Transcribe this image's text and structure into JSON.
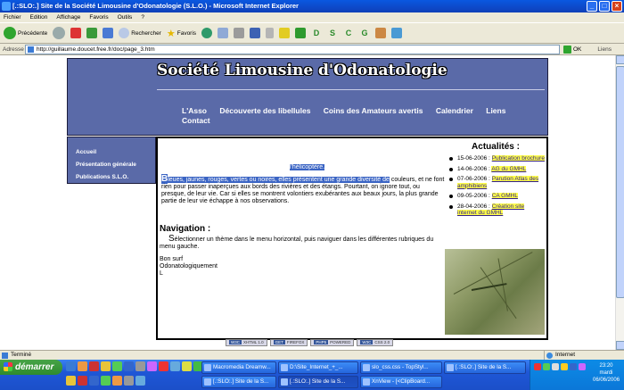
{
  "window": {
    "title": "[.:SLO:.] Site de la Société Limousine d'Odonatologie (S.L.O.) - Microsoft Internet Explorer"
  },
  "menu": [
    "Fichier",
    "Edition",
    "Affichage",
    "Favoris",
    "Outils",
    "?"
  ],
  "toolbar": {
    "back_label": "Précédente",
    "search_label": "Rechercher",
    "favorites_label": "Favoris",
    "letters": [
      "D",
      "S",
      "C",
      "G"
    ]
  },
  "address": {
    "label": "Adresse",
    "url": "http://guillaume.doucet.free.fr/doc/page_3.htm",
    "go_label": "OK",
    "links_label": "Liens"
  },
  "page": {
    "site_title": "Société Limousine d'Odonatologie",
    "nav": [
      "L'Asso",
      "Découverte des libellules",
      "Coins des Amateurs avertis",
      "Calendrier",
      "Liens",
      "Contact"
    ],
    "sidebar": [
      "Accueil",
      "Présentation générale",
      "Publications S.L.O."
    ],
    "caption": "l'hélicoptère.",
    "intro_initial": "B",
    "intro_highlight": "leues, jaunes, rouges, vertes ou noires, elles présentent une grande diversité de",
    "intro_rest": " couleurs, et ne font rien pour passer inaperçues aux bords des rivières et des étangs. Pourtant, on ignore tout, ou presque, de leur vie. Car si elles se montrent volontiers exubérantes aux beaux jours, la plus grande partie de leur vie échappe à nos observations.",
    "nav_title": "Navigation :",
    "nav_initial": "S",
    "nav_text": "électionner un thème dans le menu horizontal, puis naviguer dans les différentes rubriques du menu gauche.",
    "sign_lines": [
      "Bon surf",
      "Odonatologiquement",
      "L"
    ],
    "news_title": "Actualités :",
    "news": [
      {
        "date": "15-06-2006 :",
        "link": "Publication brochure"
      },
      {
        "date": "14-06-2006 :",
        "link": "AG du GMHL"
      },
      {
        "date": "07-06-2006 :",
        "link": "Parution Atlas des amphibiens"
      },
      {
        "date": "09-05-2006 :",
        "link": "CA GMHL"
      },
      {
        "date": "28-04-2006 :",
        "link": "Création site internet du GMHL"
      }
    ],
    "badges": [
      {
        "a": "W3C",
        "b": "XHTML 1.0"
      },
      {
        "a": "GET",
        "b": "FIREFOX"
      },
      {
        "a": "PHP5",
        "b": "POWERED"
      },
      {
        "a": "W3C",
        "b": "CSS 2.0"
      }
    ]
  },
  "status": {
    "text": "Terminé",
    "zone": "Internet"
  },
  "taskbar": {
    "start_label": "démarrer",
    "tasks_row1": [
      "Macromedia Dreamw...",
      "D:\\Site_Internet_+_...",
      "slo_css.css - TopStyl...",
      "[.:SLO:.] Site de la S..."
    ],
    "tasks_row2": [
      "[.:SLO:.] Site de la S...",
      "[.:SLO:.] Site de la S...",
      "XnView - [<ClipBoard..."
    ],
    "clock_time": "23:20",
    "clock_day": "mardi",
    "clock_date": "06/06/2006"
  }
}
